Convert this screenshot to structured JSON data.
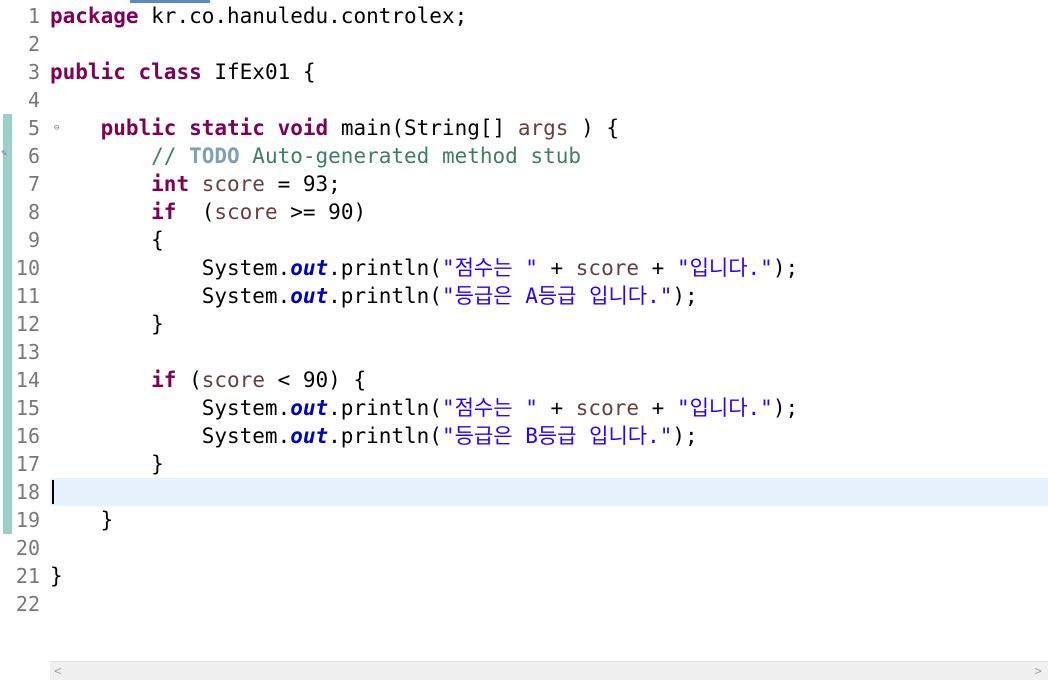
{
  "editor": {
    "current_line": 18,
    "lines": [
      {
        "n": "1",
        "tokens": [
          [
            "kw",
            "package"
          ],
          [
            "",
            "kr.co.hanuledu.controlex;"
          ]
        ]
      },
      {
        "n": "2",
        "tokens": []
      },
      {
        "n": "3",
        "tokens": [
          [
            "kw",
            "public"
          ],
          [
            "",
            ""
          ],
          [
            "kw",
            "class"
          ],
          [
            "",
            "IfEx01 {"
          ]
        ]
      },
      {
        "n": "4",
        "tokens": []
      },
      {
        "n": "5",
        "fold": true,
        "tokens": [
          [
            "",
            "    "
          ],
          [
            "kw",
            "public"
          ],
          [
            "kw",
            "static"
          ],
          [
            "kw",
            "void"
          ],
          [
            "",
            "main(String[] "
          ],
          [
            "var",
            "args"
          ],
          [
            "",
            " ) {"
          ]
        ]
      },
      {
        "n": "6",
        "tokens": [
          [
            "cm",
            "        // "
          ],
          [
            "todo",
            "TODO"
          ],
          [
            "cm",
            " Auto-generated method stub"
          ]
        ]
      },
      {
        "n": "7",
        "tokens": [
          [
            "",
            "        "
          ],
          [
            "kw",
            "int"
          ],
          [
            "var",
            "score"
          ],
          [
            "",
            " = 93;"
          ]
        ]
      },
      {
        "n": "8",
        "tokens": [
          [
            "",
            "        "
          ],
          [
            "kw",
            "if"
          ],
          [
            "",
            " ("
          ],
          [
            "var",
            "score"
          ],
          [
            "",
            " >= 90)"
          ]
        ]
      },
      {
        "n": "9",
        "tokens": [
          [
            "",
            "        {"
          ]
        ]
      },
      {
        "n": "10",
        "tokens": [
          [
            "",
            "            System."
          ],
          [
            "fld",
            "out"
          ],
          [
            "",
            ".println("
          ],
          [
            "str",
            "\"점수는 \""
          ],
          [
            "",
            " + "
          ],
          [
            "var",
            "score"
          ],
          [
            "",
            " + "
          ],
          [
            "str",
            "\"입니다.\""
          ],
          [
            "",
            ");"
          ]
        ]
      },
      {
        "n": "11",
        "tokens": [
          [
            "",
            "            System."
          ],
          [
            "fld",
            "out"
          ],
          [
            "",
            ".println("
          ],
          [
            "str",
            "\"등급은 A등급 입니다.\""
          ],
          [
            "",
            ");"
          ]
        ]
      },
      {
        "n": "12",
        "tokens": [
          [
            "",
            "        }"
          ]
        ]
      },
      {
        "n": "13",
        "tokens": []
      },
      {
        "n": "14",
        "tokens": [
          [
            "",
            "        "
          ],
          [
            "kw",
            "if"
          ],
          [
            "",
            "("
          ],
          [
            "var",
            "score"
          ],
          [
            "",
            " < 90) {"
          ]
        ]
      },
      {
        "n": "15",
        "tokens": [
          [
            "",
            "            System."
          ],
          [
            "fld",
            "out"
          ],
          [
            "",
            ".println("
          ],
          [
            "str",
            "\"점수는 \""
          ],
          [
            "",
            " + "
          ],
          [
            "var",
            "score"
          ],
          [
            "",
            " + "
          ],
          [
            "str",
            "\"입니다.\""
          ],
          [
            "",
            ");"
          ]
        ]
      },
      {
        "n": "16",
        "tokens": [
          [
            "",
            "            System."
          ],
          [
            "fld",
            "out"
          ],
          [
            "",
            ".println("
          ],
          [
            "str",
            "\"등급은 B등급 입니다.\""
          ],
          [
            "",
            ");"
          ]
        ]
      },
      {
        "n": "17",
        "tokens": [
          [
            "",
            "        }"
          ]
        ]
      },
      {
        "n": "18",
        "tokens": []
      },
      {
        "n": "19",
        "tokens": [
          [
            "",
            "    }"
          ]
        ]
      },
      {
        "n": "20",
        "tokens": []
      },
      {
        "n": "21",
        "tokens": [
          [
            "",
            "}"
          ]
        ]
      },
      {
        "n": "22",
        "tokens": []
      }
    ]
  },
  "scrollbar": {
    "left_arrow": "<",
    "right_arrow": ">"
  },
  "colors": {
    "keyword": "#7f0055",
    "string": "#2a00ff",
    "comment": "#3f7f5f",
    "todo": "#7f9fbf",
    "local_variable": "#6a3e3e",
    "static_field": "#0000c0",
    "current_line_highlight": "#e8f2fe",
    "change_bar": "#9bd1c4"
  }
}
